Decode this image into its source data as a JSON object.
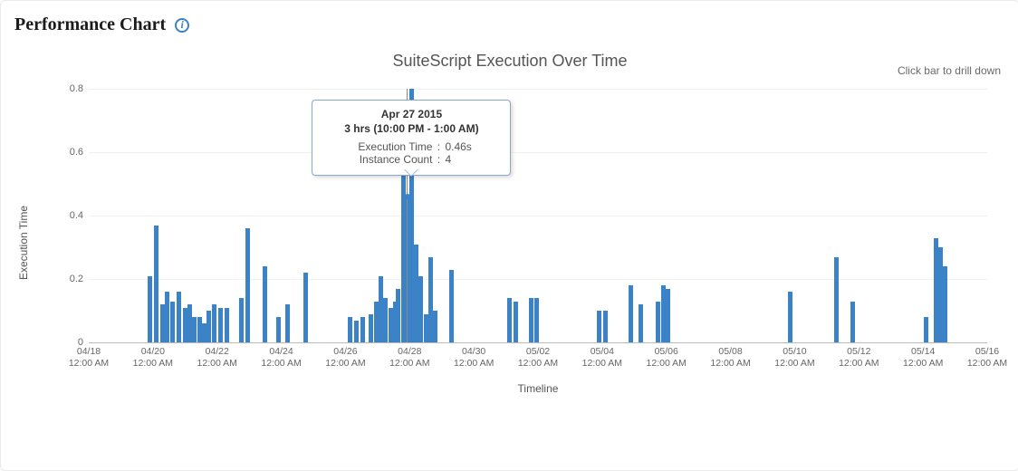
{
  "header": {
    "title": "Performance Chart",
    "info_icon_glyph": "i"
  },
  "chart": {
    "title": "SuiteScript Execution Over Time",
    "hint": "Click bar to drill down",
    "xlabel": "Timeline",
    "ylabel": "Execution Time",
    "y_ticks": [
      0,
      0.2,
      0.4,
      0.6,
      0.8
    ],
    "x_ticks": [
      {
        "day": 0,
        "date": "04/18",
        "time": "12:00 AM"
      },
      {
        "day": 2,
        "date": "04/20",
        "time": "12:00 AM"
      },
      {
        "day": 4,
        "date": "04/22",
        "time": "12:00 AM"
      },
      {
        "day": 6,
        "date": "04/24",
        "time": "12:00 AM"
      },
      {
        "day": 8,
        "date": "04/26",
        "time": "12:00 AM"
      },
      {
        "day": 10,
        "date": "04/28",
        "time": "12:00 AM"
      },
      {
        "day": 12,
        "date": "04/30",
        "time": "12:00 AM"
      },
      {
        "day": 14,
        "date": "05/02",
        "time": "12:00 AM"
      },
      {
        "day": 16,
        "date": "05/04",
        "time": "12:00 AM"
      },
      {
        "day": 18,
        "date": "05/06",
        "time": "12:00 AM"
      },
      {
        "day": 20,
        "date": "05/08",
        "time": "12:00 AM"
      },
      {
        "day": 22,
        "date": "05/10",
        "time": "12:00 AM"
      },
      {
        "day": 24,
        "date": "05/12",
        "time": "12:00 AM"
      },
      {
        "day": 26,
        "date": "05/14",
        "time": "12:00 AM"
      },
      {
        "day": 28,
        "date": "05/16",
        "time": "12:00 AM"
      }
    ]
  },
  "tooltip": {
    "date": "Apr 27 2015",
    "range": "3 hrs (10:00 PM - 1:00 AM)",
    "exec_label": "Execution Time",
    "exec_value": "0.46s",
    "count_label": "Instance Count",
    "count_value": "4"
  },
  "chart_data": {
    "type": "bar",
    "title": "SuiteScript Execution Over Time",
    "xlabel": "Timeline",
    "ylabel": "Execution Time",
    "ylim": [
      0,
      0.8
    ],
    "x_domain_days": [
      0,
      28
    ],
    "note": "x is days offset from 04/18 00:00; each bar is one 3-hour bin.",
    "highlight_x": 9.92,
    "series": [
      {
        "name": "Execution Time (s)",
        "points": [
          {
            "x": 1.9,
            "y": 0.21
          },
          {
            "x": 2.1,
            "y": 0.37
          },
          {
            "x": 2.3,
            "y": 0.12
          },
          {
            "x": 2.45,
            "y": 0.16
          },
          {
            "x": 2.6,
            "y": 0.13
          },
          {
            "x": 2.8,
            "y": 0.16
          },
          {
            "x": 3.0,
            "y": 0.11
          },
          {
            "x": 3.15,
            "y": 0.12
          },
          {
            "x": 3.3,
            "y": 0.08
          },
          {
            "x": 3.45,
            "y": 0.08
          },
          {
            "x": 3.6,
            "y": 0.06
          },
          {
            "x": 3.75,
            "y": 0.1
          },
          {
            "x": 3.9,
            "y": 0.12
          },
          {
            "x": 4.1,
            "y": 0.11
          },
          {
            "x": 4.3,
            "y": 0.11
          },
          {
            "x": 4.75,
            "y": 0.14
          },
          {
            "x": 4.95,
            "y": 0.36
          },
          {
            "x": 5.5,
            "y": 0.24
          },
          {
            "x": 5.9,
            "y": 0.08
          },
          {
            "x": 6.2,
            "y": 0.12
          },
          {
            "x": 6.75,
            "y": 0.22
          },
          {
            "x": 8.15,
            "y": 0.08
          },
          {
            "x": 8.35,
            "y": 0.07
          },
          {
            "x": 8.55,
            "y": 0.08
          },
          {
            "x": 8.8,
            "y": 0.09
          },
          {
            "x": 8.95,
            "y": 0.13
          },
          {
            "x": 9.1,
            "y": 0.21
          },
          {
            "x": 9.25,
            "y": 0.14
          },
          {
            "x": 9.4,
            "y": 0.11
          },
          {
            "x": 9.55,
            "y": 0.13
          },
          {
            "x": 9.65,
            "y": 0.17
          },
          {
            "x": 9.8,
            "y": 0.7
          },
          {
            "x": 9.92,
            "y": 0.46
          },
          {
            "x": 10.05,
            "y": 0.8
          },
          {
            "x": 10.2,
            "y": 0.31
          },
          {
            "x": 10.35,
            "y": 0.21
          },
          {
            "x": 10.5,
            "y": 0.09
          },
          {
            "x": 10.65,
            "y": 0.27
          },
          {
            "x": 10.8,
            "y": 0.1
          },
          {
            "x": 11.3,
            "y": 0.23
          },
          {
            "x": 13.1,
            "y": 0.14
          },
          {
            "x": 13.3,
            "y": 0.13
          },
          {
            "x": 13.8,
            "y": 0.14
          },
          {
            "x": 13.95,
            "y": 0.14
          },
          {
            "x": 15.9,
            "y": 0.1
          },
          {
            "x": 16.1,
            "y": 0.1
          },
          {
            "x": 16.9,
            "y": 0.18
          },
          {
            "x": 17.2,
            "y": 0.12
          },
          {
            "x": 17.75,
            "y": 0.13
          },
          {
            "x": 17.9,
            "y": 0.18
          },
          {
            "x": 18.05,
            "y": 0.17
          },
          {
            "x": 21.85,
            "y": 0.16
          },
          {
            "x": 23.3,
            "y": 0.27
          },
          {
            "x": 23.8,
            "y": 0.13
          },
          {
            "x": 26.1,
            "y": 0.08
          },
          {
            "x": 26.4,
            "y": 0.33
          },
          {
            "x": 26.55,
            "y": 0.3
          },
          {
            "x": 26.7,
            "y": 0.24
          }
        ]
      }
    ]
  }
}
